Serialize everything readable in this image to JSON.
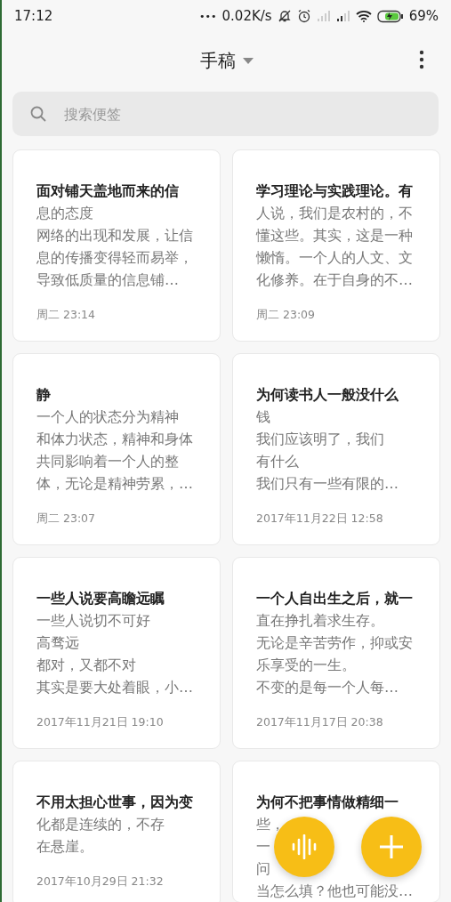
{
  "status_bar": {
    "time": "17:12",
    "more": "•••",
    "speed": "0.02K/s",
    "battery": "69%"
  },
  "header": {
    "title": "手稿"
  },
  "search": {
    "placeholder": "搜索便签"
  },
  "notes": [
    {
      "title": "面对铺天盖地而来的信",
      "lines": [
        "息的态度",
        "网络的出现和发展，让信",
        "息的传播变得轻而易举，",
        "导致低质量的信息铺…"
      ],
      "date": "周二 23:14"
    },
    {
      "title": "学习理论与实践理论。有",
      "lines": [
        "人说，我们是农村的，不",
        "懂这些。其实，这是一种",
        "懒惰。一个人的人文、文",
        "化修养。在于自身的不…"
      ],
      "date": "周二 23:09"
    },
    {
      "title": "静",
      "lines": [
        "一个人的状态分为精神",
        "和体力状态，精神和身体",
        "共同影响着一个人的整",
        "体，无论是精神劳累，…"
      ],
      "date": "周二 23:07"
    },
    {
      "title": "为何读书人一般没什么",
      "lines": [
        "钱",
        "我们应该明了，我们",
        "有什么",
        "我们只有一些有限的…"
      ],
      "date": "2017年11月22日 12:58"
    },
    {
      "title": "一些人说要高瞻远瞩",
      "lines": [
        "一些人说切不可好",
        "高骛远",
        "都对，又都不对",
        "其实是要大处着眼，小…"
      ],
      "date": "2017年11月21日 19:10"
    },
    {
      "title": "一个人自出生之后，就一",
      "lines": [
        "直在挣扎着求生存。",
        "无论是辛苦劳作，抑或安",
        "乐享受的一生。",
        "不变的是每一个人每…"
      ],
      "date": "2017年11月17日 20:38"
    },
    {
      "title": "不用太担心世事，因为变",
      "lines": [
        "化都是连续的，不存",
        "在悬崖。"
      ],
      "date": "2017年10月29日 21:32"
    },
    {
      "title": "为何不把事情做精细一",
      "lines": [
        "些，",
        "一",
        "问",
        "当怎么填？他也可能没…"
      ]
    }
  ]
}
